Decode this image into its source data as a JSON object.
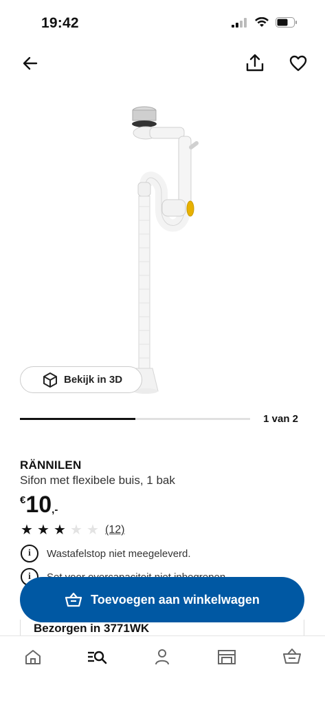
{
  "status_bar": {
    "time": "19:42"
  },
  "nav": {
    "back_icon": "arrow-left-icon",
    "share_icon": "share-icon",
    "favorite_icon": "heart-icon"
  },
  "view_3d": {
    "label": "Bekijk in 3D",
    "icon": "cube-icon"
  },
  "carousel": {
    "counter": "1 van 2",
    "progress": 0.5
  },
  "product": {
    "name": "RÄNNILEN",
    "description": "Sifon met flexibele buis, 1 bak",
    "price": {
      "currency": "€",
      "integer": "10",
      "decimal": ",-"
    },
    "rating": {
      "stars": 3,
      "max": 5,
      "count": "(12)"
    }
  },
  "info": [
    {
      "text": "Wastafelstop niet meegeleverd.",
      "icon": "info-icon"
    },
    {
      "text": "Set voor overcapaciteit niet inbegrepen.",
      "icon": "info-icon"
    }
  ],
  "cart": {
    "label": "Toevoegen aan winkelwagen",
    "icon": "basket-icon",
    "color": "#0058a3"
  },
  "delivery": {
    "text": "Bezorgen in 3771WK"
  },
  "bottom_nav": [
    {
      "icon": "home-icon"
    },
    {
      "icon": "search-icon",
      "active": true
    },
    {
      "icon": "profile-icon"
    },
    {
      "icon": "store-icon"
    },
    {
      "icon": "basket-icon"
    }
  ]
}
